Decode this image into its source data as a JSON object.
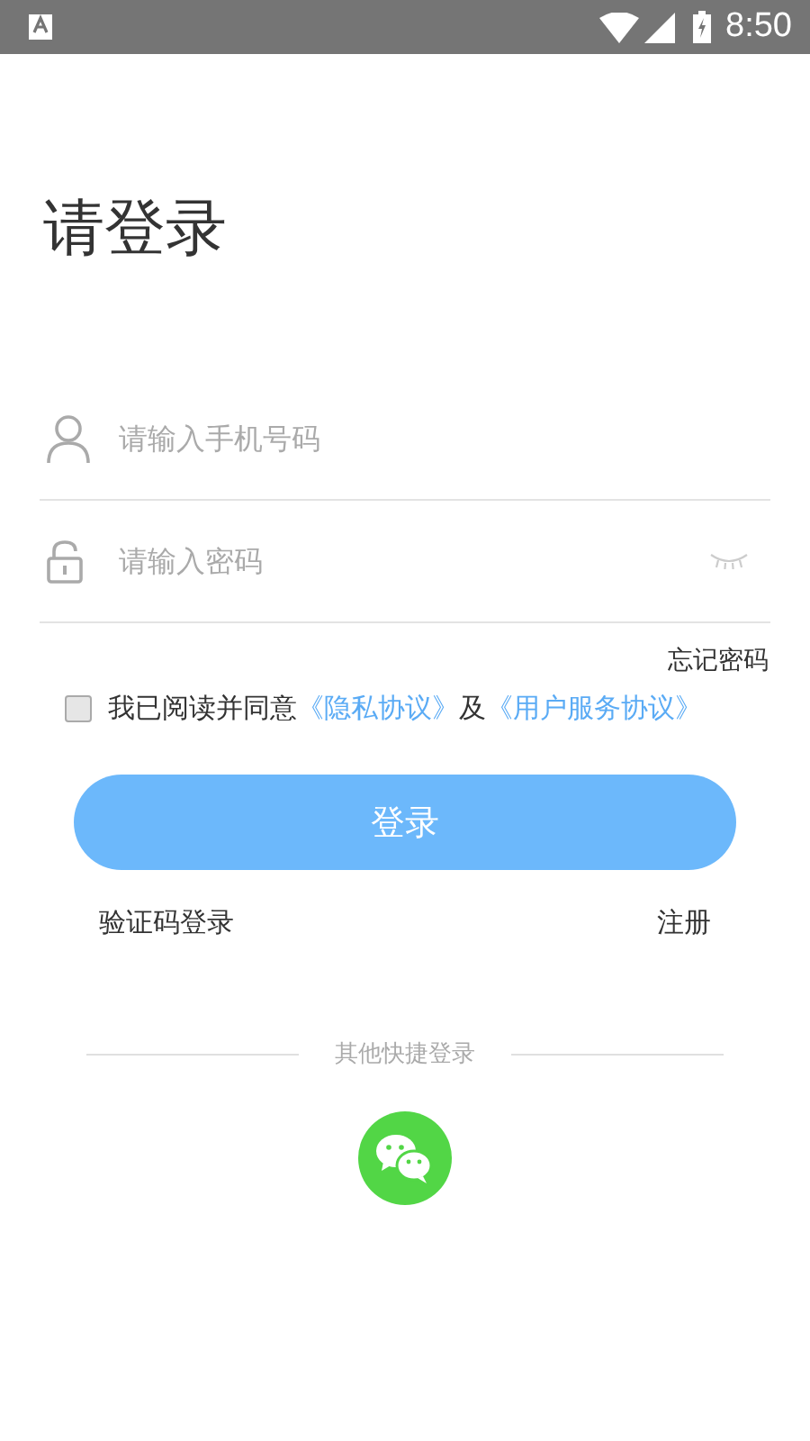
{
  "status_bar": {
    "time": "8:50"
  },
  "title": "请登录",
  "fields": [
    {
      "kind": "phone",
      "placeholder": "请输入手机号码"
    },
    {
      "kind": "password",
      "placeholder": "请输入密码",
      "password_visible": false
    }
  ],
  "forgot_password": "忘记密码",
  "agreement": {
    "checked": false,
    "parts": [
      {
        "kind": "plain",
        "text": "我已阅读并同意"
      },
      {
        "kind": "link",
        "text": "《隐私协议》"
      },
      {
        "kind": "plain",
        "text": "及"
      },
      {
        "kind": "link",
        "text": "《用户服务协议》"
      }
    ]
  },
  "login_button": "登录",
  "sms_login": "验证码登录",
  "register": "注册",
  "other_login": {
    "label": "其他快捷登录",
    "providers": [
      {
        "kind": "wechat"
      }
    ]
  }
}
